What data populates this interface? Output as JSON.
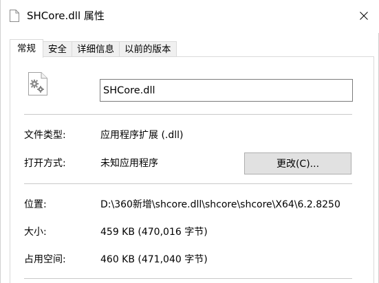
{
  "window": {
    "title": "SHCore.dll 属性"
  },
  "tabs": [
    {
      "label": "常规",
      "active": true
    },
    {
      "label": "安全",
      "active": false
    },
    {
      "label": "详细信息",
      "active": false
    },
    {
      "label": "以前的版本",
      "active": false
    }
  ],
  "general": {
    "file_name": "SHCore.dll",
    "file_icon": "dll-file-gear-icon",
    "file_type_label": "文件类型:",
    "file_type_value": "应用程序扩展 (.dll)",
    "opens_with_label": "打开方式:",
    "opens_with_value": "未知应用程序",
    "change_button_label": "更改(C)...",
    "location_label": "位置:",
    "location_value": "D:\\360新增\\shcore.dll\\shcore\\shcore\\X64\\6.2.8250",
    "size_label": "大小:",
    "size_value": "459 KB (470,016 字节)",
    "size_on_disk_label": "占用空间:",
    "size_on_disk_value": "460 KB (471,040 字节)"
  },
  "colors": {
    "button_bg": "#e1e1e1",
    "button_border": "#adadad",
    "tab_bg": "#f0f0f0",
    "separator": "#c8c8c8"
  }
}
